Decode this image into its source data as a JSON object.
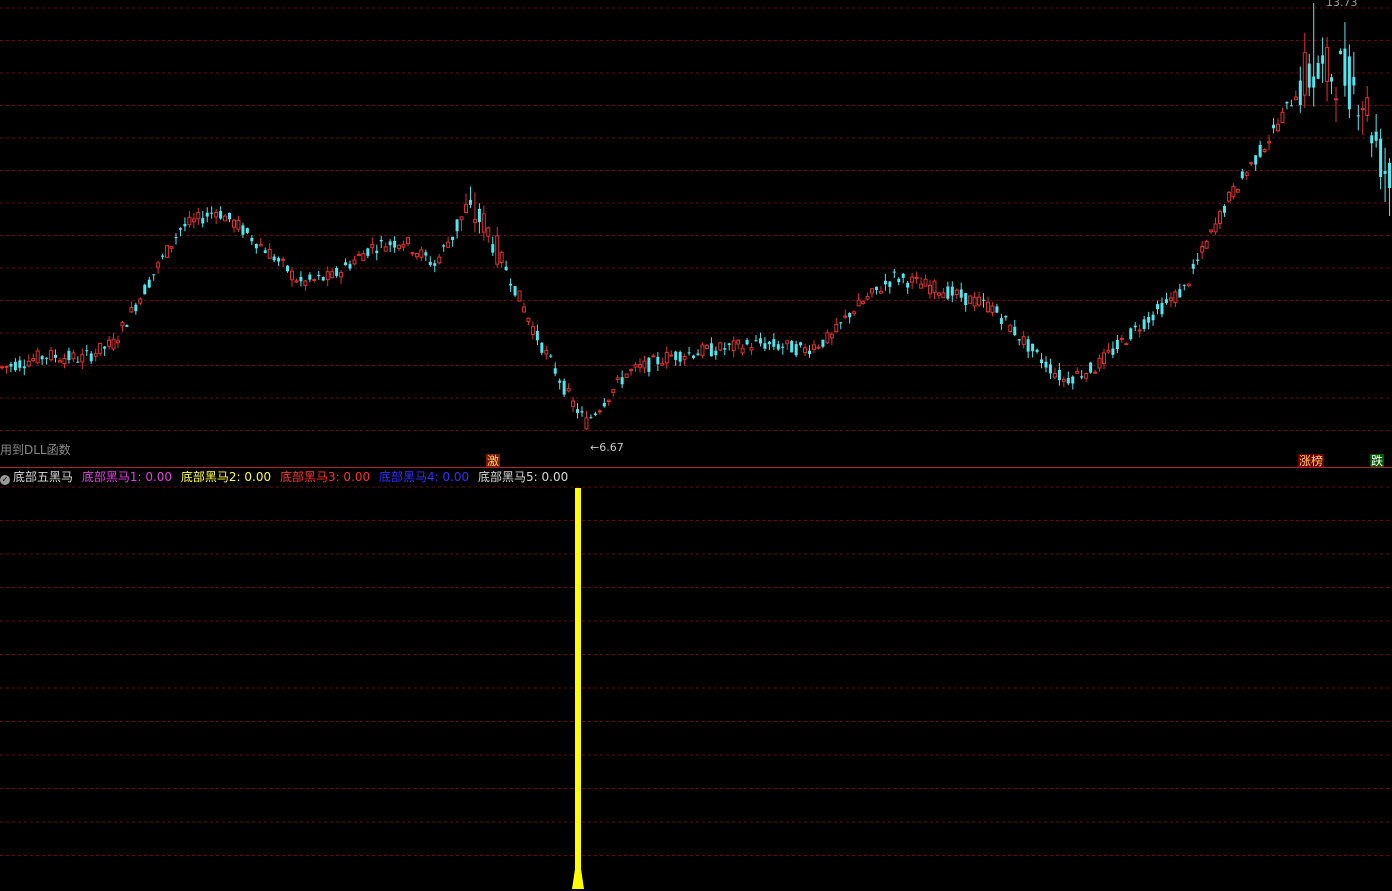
{
  "price_panel": {
    "note": "用到DLL函数",
    "low_label": "6.67",
    "high_label": "13.73",
    "tags": {
      "ji": "激",
      "zhangbang": "涨榜",
      "die": "跌"
    },
    "colors": {
      "up": "#e03030",
      "down": "#50e8f0",
      "grid": "#5a1010"
    }
  },
  "indicator": {
    "name": "底部五黑马",
    "series": [
      {
        "label": "底部黑马1: 0.00",
        "color": "#e040e0"
      },
      {
        "label": "底部黑马2: 0.00",
        "color": "#ffff40"
      },
      {
        "label": "底部黑马3: 0.00",
        "color": "#ff3030"
      },
      {
        "label": "底部黑马4: 0.00",
        "color": "#3030ff"
      },
      {
        "label": "底部黑马5: 0.00",
        "color": "#d8d8d8"
      }
    ],
    "signal_color": "#ffff00"
  },
  "chart_data": {
    "type": "candlestick",
    "low": 6.67,
    "high": 13.73,
    "bars": 260,
    "signal_bar_index": 107
  }
}
